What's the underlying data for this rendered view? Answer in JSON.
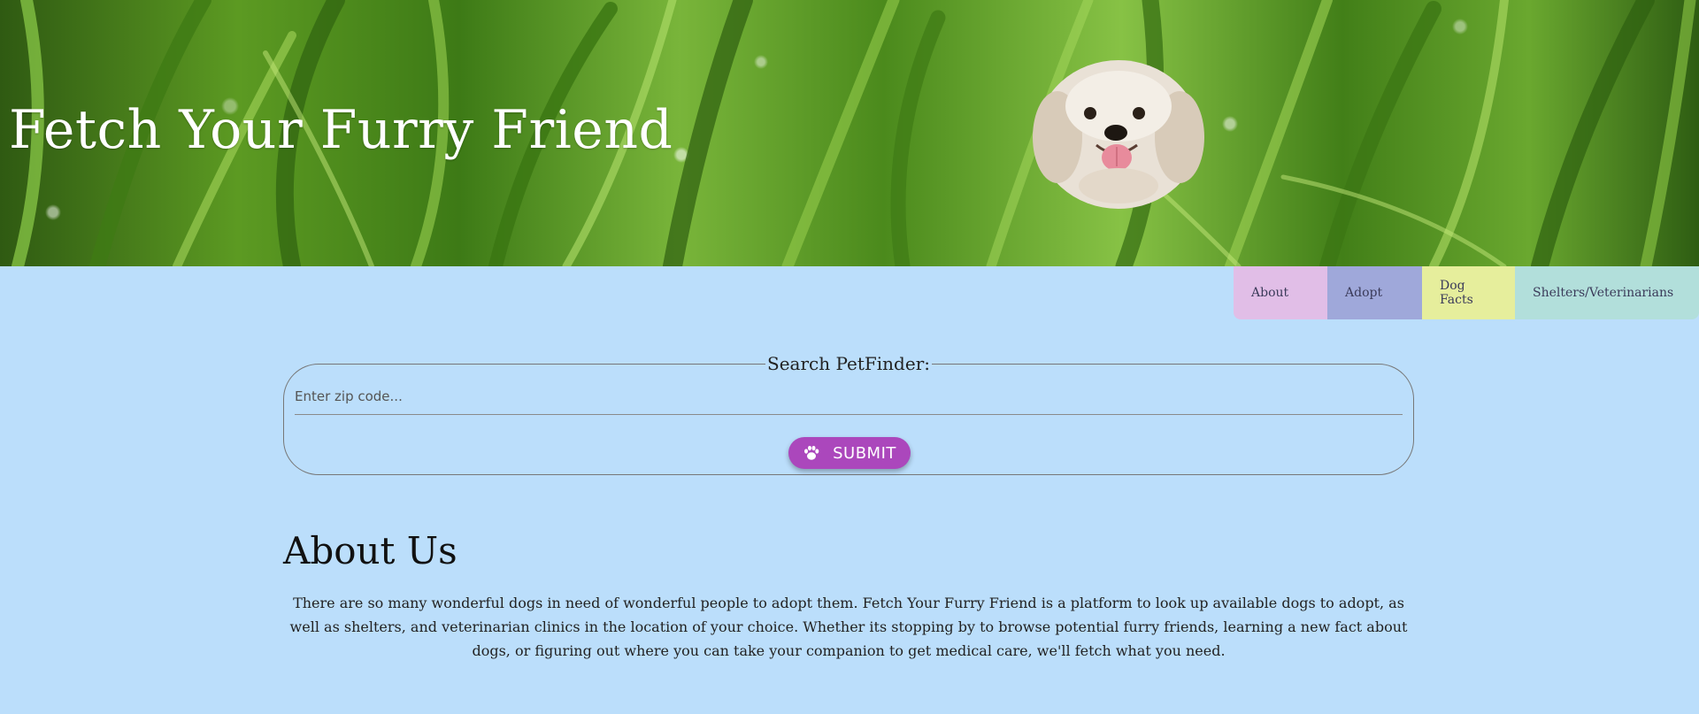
{
  "header": {
    "title": "Fetch Your Furry Friend"
  },
  "nav": {
    "items": [
      {
        "label": "About",
        "color": "#e1bee7"
      },
      {
        "label": "Adopt",
        "color": "#9fa8da"
      },
      {
        "label": "Dog Facts",
        "color": "#e6ee9c"
      },
      {
        "label": "Shelters/Veterinarians",
        "color": "#b2dfdb"
      }
    ]
  },
  "search": {
    "legend": "Search PetFinder:",
    "placeholder": "Enter zip code...",
    "value": "",
    "submit_label": "SUBMIT",
    "submit_icon": "paw-icon",
    "submit_color": "#ab47bc"
  },
  "about": {
    "title": "About Us",
    "text": "There are so many wonderful dogs in need of wonderful people to adopt them. Fetch Your Furry Friend is a platform to look up available dogs to adopt, as well as shelters, and veterinarian clinics in the location of your choice. Whether its stopping by to browse potential furry friends, learning a new fact about dogs, or figuring out where you can take your companion to get medical care, we'll fetch what you need."
  },
  "colors": {
    "page_background": "#bbdefb"
  }
}
